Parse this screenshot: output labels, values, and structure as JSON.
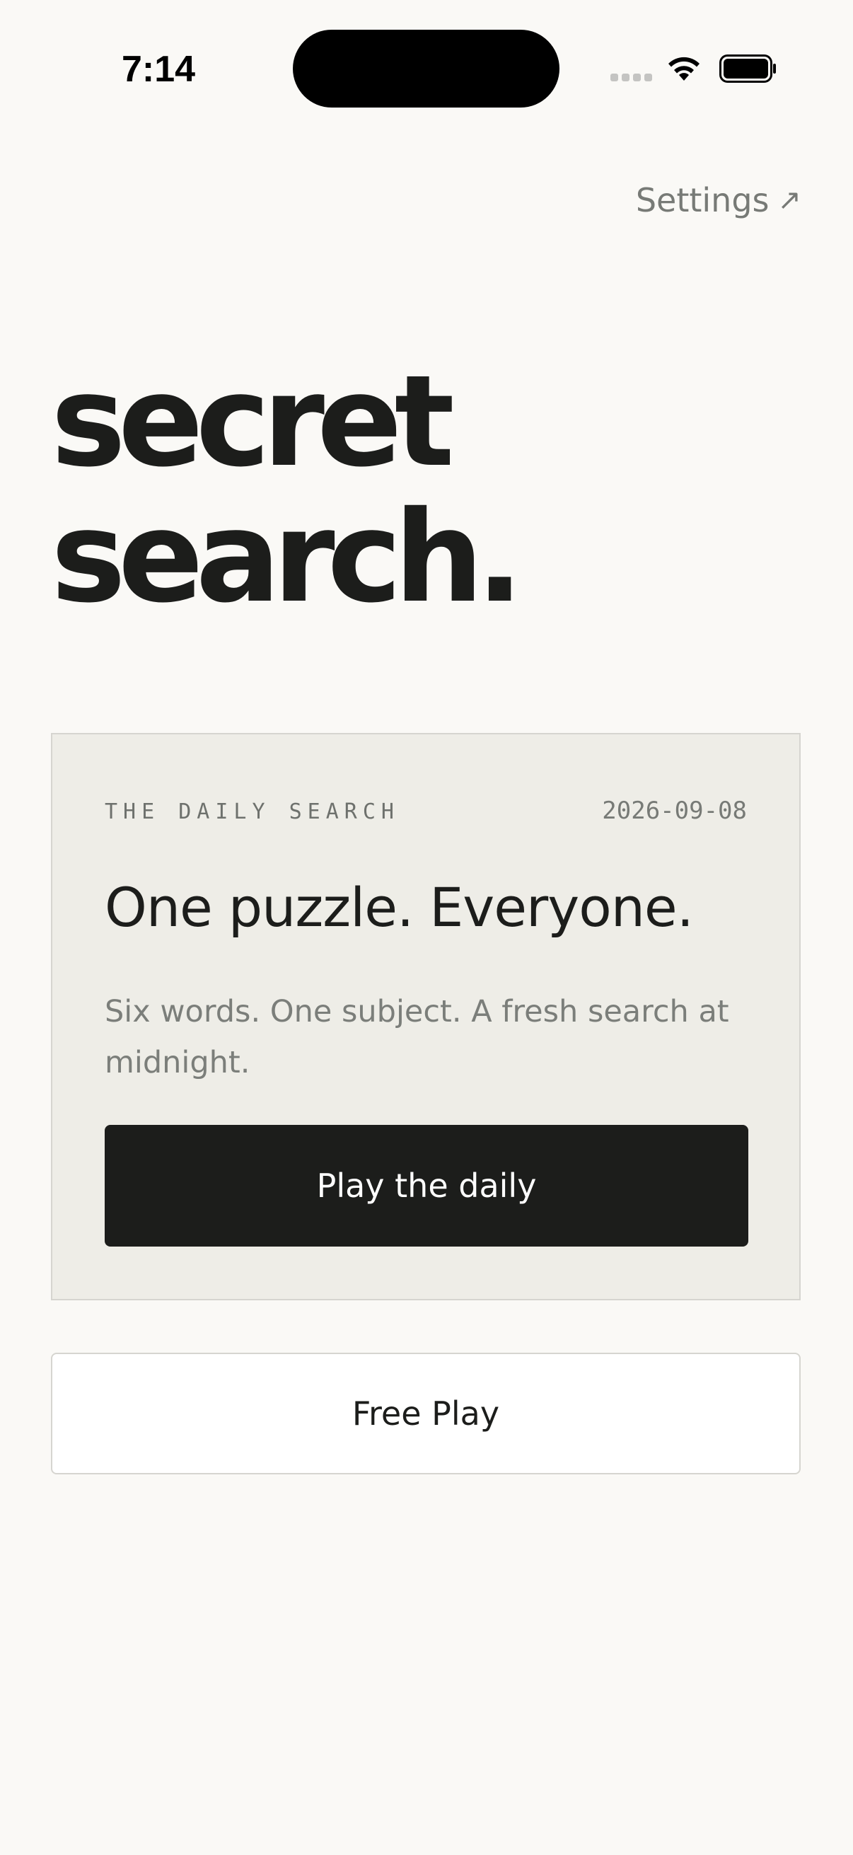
{
  "status_bar": {
    "time": "7:14",
    "icons": [
      "cellular-signal-icon",
      "wifi-icon",
      "battery-icon"
    ]
  },
  "header": {
    "settings_label": "Settings",
    "settings_arrow": "↗",
    "settings_icon": "arrow-up-right-icon"
  },
  "title": {
    "line1": "secret",
    "line2": "search."
  },
  "daily_card": {
    "eyebrow": "THE DAILY SEARCH",
    "date": "2026-09-08",
    "heading": "One puzzle. Everyone.",
    "description": "Six words. One subject. A fresh search at midnight.",
    "button_label": "Play the daily"
  },
  "free_play": {
    "button_label": "Free Play"
  },
  "colors": {
    "background": "#faf9f6",
    "ink": "#1c1d1b",
    "card_bg": "#eeede7",
    "muted_text": "#777a76",
    "border": "#d6d5d0"
  }
}
